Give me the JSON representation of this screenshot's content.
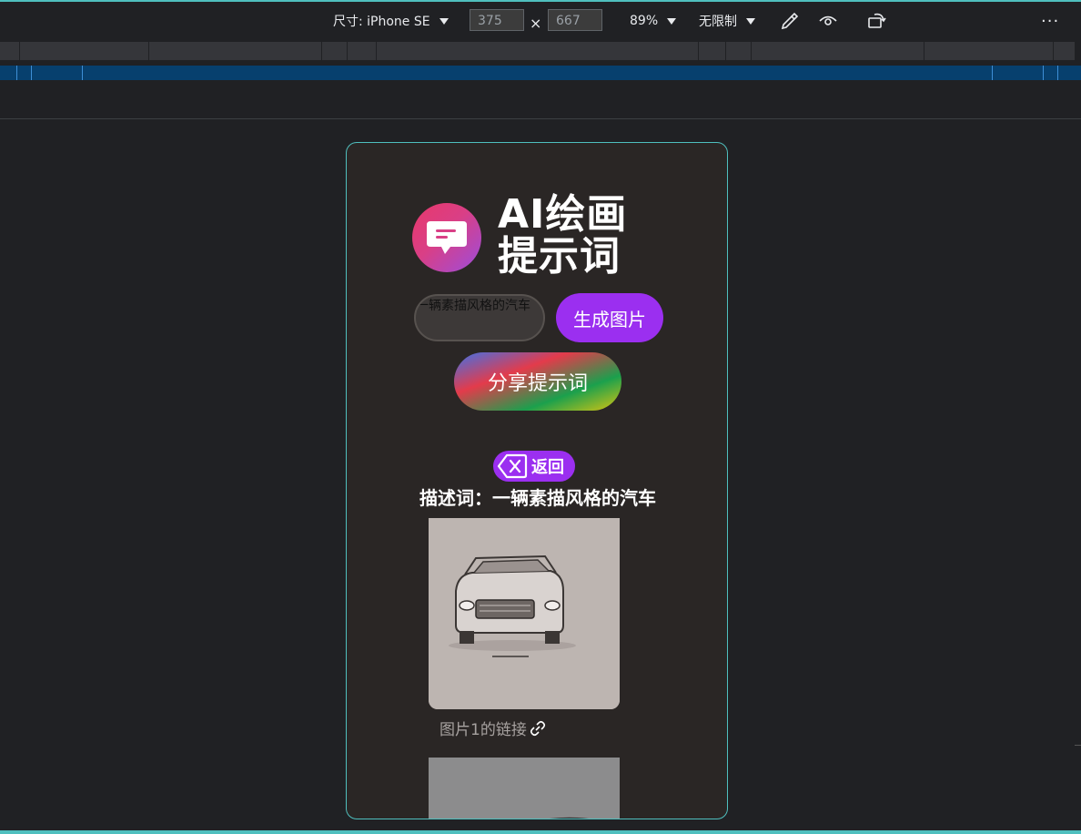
{
  "toolbar": {
    "dimension_label": "尺寸: iPhone SE",
    "width_value": "375",
    "height_value": "667",
    "times": "×",
    "zoom_label": "89%",
    "throttle_label": "无限制",
    "more_label": "···"
  },
  "app": {
    "title_line1": "AI绘画",
    "title_line2": "提示词",
    "prompt_value": "一辆素描风格的汽车",
    "generate_label": "生成图片",
    "share_label": "分享提示词",
    "back_label": "返回",
    "description": "描述词：一辆素描风格的汽车",
    "image_link_label": "图片1的链接"
  },
  "colors": {
    "accent": "#9b2ff0",
    "viewport_bg": "#2a2625",
    "viewport_border": "#4fbfbe"
  }
}
